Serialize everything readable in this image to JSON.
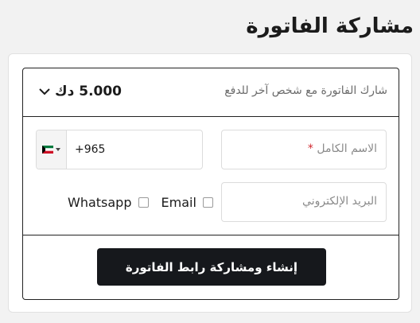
{
  "page": {
    "title": "مشاركة الفاتورة"
  },
  "share": {
    "label": "شارك الفاتورة مع شخص آخر للدفع",
    "amount": "5.000 دك"
  },
  "form": {
    "full_name_placeholder": "الاسم الكامل",
    "required_marker": "*",
    "country_flag": "kuwait-flag",
    "dial_code": "+965",
    "email_placeholder": "البريد الإلكتروني",
    "options": {
      "whatsapp_label": "Whatsapp",
      "email_label": "Email"
    }
  },
  "actions": {
    "create_share_label": "إنشاء ومشاركة رابط الفاتورة"
  },
  "colors": {
    "button_bg": "#16181c",
    "required": "#d0282f",
    "border": "#222222"
  }
}
